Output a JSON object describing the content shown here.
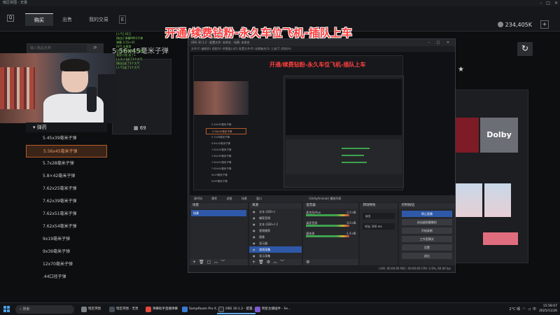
{
  "game": {
    "window_title": "暗区突围 - 无畏",
    "tabs": [
      "购买",
      "出售",
      "我的交易"
    ],
    "tab_extra": "E",
    "search_placeholder": "输入物品名称",
    "item_title": "5.56x45毫米子弹",
    "balance": "234,405K",
    "item_price": "69",
    "ammo_header": "弹药",
    "ammo_list": [
      "5.45x39毫米子弹",
      "5.56x45毫米子弹",
      "5.7x28毫米子弹",
      "5.8×42毫米子弹",
      "7.62x25毫米子弹",
      "7.62x39毫米子弹",
      "7.62x51毫米子弹",
      "7.62x54毫米子弹",
      "9x19毫米子弹",
      "9x39毫米子弹",
      "12x70毫米子弹",
      ".44口径子弹"
    ],
    "selected_index": 1,
    "right_card_label": "Dolby"
  },
  "stream": {
    "banner": "开通/续费钻粉-永久车位飞机-插队上车",
    "nested_banner": "开通/续费钻粉-永久车位飞机-插队上车",
    "chat": [
      "[人气] 45万",
      "[粉丝] 弹幕MI93子弹",
      "弹幕 3.55+45",
      "[97] 无畏哥",
      "[抖音]MJ48Bd 下面那个",
      "我是小旭 送了1",
      "[上大人]送了1个大气",
      "[粉丝]送了1个大气",
      "[人气]送了1个大气"
    ]
  },
  "obs": {
    "title": "OBS 30.1.2 - 配置文件: 未命名 - 场景: 未命名",
    "menu": "文件(F)  编辑(E)  视图(V)  停靠窗口(D)  配置文件(P)  场景集合(S)  工具(T)  帮助(H)",
    "dock_tabs": [
      "源代码",
      "属性",
      "滤镜",
      "场景",
      "窗口",
      "(UnityArsenal) 播放列表"
    ],
    "docks": {
      "scenes": {
        "title": "场景",
        "items": [
          "场景"
        ]
      },
      "sources": {
        "title": "来源",
        "items": [
          "文本 (GDI+)",
          "捕获音频",
          "文本 (GDI+) 2",
          "视频捕获",
          "图像",
          "显示器",
          "游戏采集",
          "显示采集"
        ],
        "selected_index": 6
      },
      "mixer": {
        "title": "混音器",
        "rows": [
          {
            "name": "麦克风/Aux",
            "db": "-2.0 dB"
          },
          {
            "name": "桌面音频",
            "db": "0.0 dB"
          },
          {
            "name": "媒体源",
            "db": "-1.6 dB"
          }
        ]
      },
      "transitions": {
        "title": "转场特效",
        "type": "淡出",
        "duration_label": "时长",
        "duration": "300 ms"
      },
      "controls": {
        "title": "控制按钮",
        "buttons": [
          "停止直播",
          "启动虚拟摄像机",
          "开始录制",
          "工作室模式",
          "设置",
          "退出"
        ]
      }
    },
    "status": "LIVE: 00:00:00   REC: 00:00:00   CPU: 2.6%, 60.00 fps"
  },
  "taskbar": {
    "search": "搜索",
    "apps": [
      {
        "label": "暗区突围",
        "color": "#7b7f86"
      },
      {
        "label": "暗区突围 - 无畏",
        "color": "#444a55"
      },
      {
        "label": "弹幕助手直播弹幕",
        "color": "#e24a3b"
      },
      {
        "label": "SampRoute Pro X...",
        "color": "#3a7bd5"
      },
      {
        "label": "OBS 30.1.2 - 配置...",
        "color": "#2b2b2b"
      },
      {
        "label": "明星主播插件 - Se...",
        "color": "#7f5ad0"
      }
    ],
    "weather": "2°C 晴",
    "lang": "中",
    "time": "15:58:07",
    "date": "2025/11/26"
  }
}
